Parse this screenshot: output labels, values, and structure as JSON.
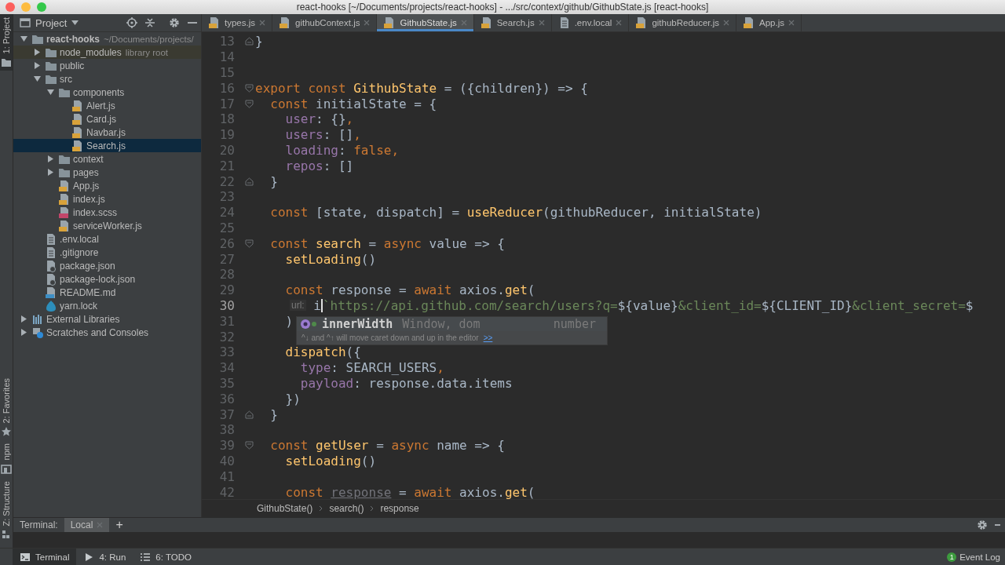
{
  "window": {
    "title": "react-hooks [~/Documents/projects/react-hooks] - .../src/context/github/GithubState.js [react-hooks]"
  },
  "tool_strip": [
    {
      "label": "1: Project",
      "selected": true
    },
    {
      "label": "2: Favorites",
      "selected": false
    },
    {
      "label": "npm",
      "selected": false
    },
    {
      "label": "Z: Structure",
      "selected": false
    }
  ],
  "project_panel": {
    "title": "Project",
    "tree": [
      {
        "label": "react-hooks",
        "hint": "~/Documents/projects/",
        "kind": "root",
        "expanded": true,
        "selected": false,
        "children": [
          {
            "label": "node_modules",
            "hint": "library root",
            "kind": "library-folder",
            "expanded": false,
            "selected": false
          },
          {
            "label": "public",
            "kind": "folder",
            "expanded": false,
            "selected": false
          },
          {
            "label": "src",
            "kind": "folder",
            "expanded": true,
            "selected": false,
            "children": [
              {
                "label": "components",
                "kind": "folder",
                "expanded": true,
                "selected": false,
                "children": [
                  {
                    "label": "Alert.js",
                    "kind": "js",
                    "selected": false
                  },
                  {
                    "label": "Card.js",
                    "kind": "js",
                    "selected": false
                  },
                  {
                    "label": "Navbar.js",
                    "kind": "js",
                    "selected": false
                  },
                  {
                    "label": "Search.js",
                    "kind": "js",
                    "selected": true
                  }
                ]
              },
              {
                "label": "context",
                "kind": "folder",
                "expanded": false,
                "selected": false
              },
              {
                "label": "pages",
                "kind": "folder",
                "expanded": false,
                "selected": false
              },
              {
                "label": "App.js",
                "kind": "js",
                "selected": false
              },
              {
                "label": "index.js",
                "kind": "js",
                "selected": false
              },
              {
                "label": "index.scss",
                "kind": "sass",
                "selected": false
              },
              {
                "label": "serviceWorker.js",
                "kind": "js",
                "selected": false
              }
            ]
          },
          {
            "label": ".env.local",
            "kind": "text",
            "selected": false
          },
          {
            "label": ".gitignore",
            "kind": "text",
            "selected": false
          },
          {
            "label": "package.json",
            "kind": "json",
            "selected": false
          },
          {
            "label": "package-lock.json",
            "kind": "json",
            "selected": false
          },
          {
            "label": "README.md",
            "kind": "md",
            "selected": false
          },
          {
            "label": "yarn.lock",
            "kind": "yarn",
            "selected": false
          }
        ]
      },
      {
        "label": "External Libraries",
        "kind": "libraries",
        "expanded": false,
        "selected": false
      },
      {
        "label": "Scratches and Consoles",
        "kind": "scratches",
        "expanded": false,
        "selected": false
      }
    ]
  },
  "tabs": [
    {
      "label": "types.js",
      "kind": "js",
      "selected": false
    },
    {
      "label": "githubContext.js",
      "kind": "js",
      "selected": false
    },
    {
      "label": "GithubState.js",
      "kind": "js",
      "selected": true
    },
    {
      "label": "Search.js",
      "kind": "js",
      "selected": false
    },
    {
      "label": ".env.local",
      "kind": "text",
      "selected": false
    },
    {
      "label": "githubReducer.js",
      "kind": "js",
      "selected": false
    },
    {
      "label": "App.js",
      "kind": "js",
      "selected": false
    }
  ],
  "code": [
    {
      "number": "13",
      "current": false,
      "fold_end": true,
      "tokens": [
        {
          "kind": "plain",
          "text": "}"
        }
      ]
    },
    {
      "number": "14",
      "current": false
    },
    {
      "number": "15",
      "current": false
    },
    {
      "number": "16",
      "current": false,
      "fold_start": true,
      "tokens": [
        {
          "kind": "kw",
          "text": "export const "
        },
        {
          "kind": "fn",
          "text": "GithubState"
        },
        {
          "kind": "plain",
          "text": " = ({children}) => {"
        }
      ]
    },
    {
      "number": "17",
      "current": false,
      "fold_start": true,
      "tokens": [
        {
          "kind": "kw",
          "text": "  const "
        },
        {
          "kind": "plain",
          "text": "initialState = {"
        }
      ]
    },
    {
      "number": "18",
      "current": false,
      "tokens": [
        {
          "kind": "prop",
          "text": "    user"
        },
        {
          "kind": "plain",
          "text": ": {}"
        },
        {
          "kind": "kw",
          "text": ","
        }
      ]
    },
    {
      "number": "19",
      "current": false,
      "tokens": [
        {
          "kind": "prop",
          "text": "    users"
        },
        {
          "kind": "plain",
          "text": ": []"
        },
        {
          "kind": "kw",
          "text": ","
        }
      ]
    },
    {
      "number": "20",
      "current": false,
      "tokens": [
        {
          "kind": "prop",
          "text": "    loading"
        },
        {
          "kind": "plain",
          "text": ": "
        },
        {
          "kind": "kw",
          "text": "false,"
        }
      ]
    },
    {
      "number": "21",
      "current": false,
      "tokens": [
        {
          "kind": "prop",
          "text": "    repos"
        },
        {
          "kind": "plain",
          "text": ": []"
        }
      ]
    },
    {
      "number": "22",
      "current": false,
      "fold_end": true,
      "tokens": [
        {
          "kind": "plain",
          "text": "  }"
        }
      ]
    },
    {
      "number": "23",
      "current": false
    },
    {
      "number": "24",
      "current": false,
      "tokens": [
        {
          "kind": "kw",
          "text": "  const "
        },
        {
          "kind": "plain",
          "text": "[state, dispatch] = "
        },
        {
          "kind": "fn",
          "text": "useReducer"
        },
        {
          "kind": "plain",
          "text": "(githubReducer, initialState)"
        }
      ]
    },
    {
      "number": "25",
      "current": false
    },
    {
      "number": "26",
      "current": false,
      "fold_start": true,
      "tokens": [
        {
          "kind": "kw",
          "text": "  const "
        },
        {
          "kind": "fn",
          "text": "search"
        },
        {
          "kind": "plain",
          "text": " = "
        },
        {
          "kind": "kw",
          "text": "async "
        },
        {
          "kind": "plain",
          "text": "value => {"
        }
      ]
    },
    {
      "number": "27",
      "current": false,
      "tokens": [
        {
          "kind": "fn",
          "text": "    setLoading"
        },
        {
          "kind": "plain",
          "text": "()"
        }
      ]
    },
    {
      "number": "28",
      "current": false
    },
    {
      "number": "29",
      "current": false,
      "tokens": [
        {
          "kind": "kw",
          "text": "    const "
        },
        {
          "kind": "plain",
          "text": "response = "
        },
        {
          "kind": "kw",
          "text": "await "
        },
        {
          "kind": "plain",
          "text": "axios."
        },
        {
          "kind": "fn",
          "text": "get"
        },
        {
          "kind": "plain",
          "text": "("
        }
      ]
    },
    {
      "number": "30",
      "current": true,
      "tokens": [
        {
          "kind": "hint",
          "text": "url:"
        },
        {
          "kind": "plain",
          "text": " i"
        },
        {
          "kind": "caret"
        },
        {
          "kind": "str",
          "text": "`https://api.github.com/search/users?q="
        },
        {
          "kind": "plain",
          "text": "${value}"
        },
        {
          "kind": "str",
          "text": "&client_id="
        },
        {
          "kind": "plain",
          "text": "${CLIENT_ID}"
        },
        {
          "kind": "str",
          "text": "&client_secret="
        },
        {
          "kind": "plain",
          "text": "$"
        }
      ]
    },
    {
      "number": "31",
      "current": false,
      "tokens": [
        {
          "kind": "plain",
          "text": "    )"
        }
      ]
    },
    {
      "number": "32",
      "current": false
    },
    {
      "number": "33",
      "current": false,
      "tokens": [
        {
          "kind": "fn",
          "text": "    dispatch"
        },
        {
          "kind": "plain",
          "text": "({"
        }
      ]
    },
    {
      "number": "34",
      "current": false,
      "tokens": [
        {
          "kind": "prop",
          "text": "      type"
        },
        {
          "kind": "plain",
          "text": ": SEARCH_USERS"
        },
        {
          "kind": "kw",
          "text": ","
        }
      ]
    },
    {
      "number": "35",
      "current": false,
      "tokens": [
        {
          "kind": "prop",
          "text": "      payload"
        },
        {
          "kind": "plain",
          "text": ": response.data.items"
        }
      ]
    },
    {
      "number": "36",
      "current": false,
      "tokens": [
        {
          "kind": "plain",
          "text": "    })"
        }
      ]
    },
    {
      "number": "37",
      "current": false,
      "fold_end": true,
      "tokens": [
        {
          "kind": "plain",
          "text": "  }"
        }
      ]
    },
    {
      "number": "38",
      "current": false
    },
    {
      "number": "39",
      "current": false,
      "fold_start": true,
      "tokens": [
        {
          "kind": "kw",
          "text": "  const "
        },
        {
          "kind": "fn",
          "text": "getUser"
        },
        {
          "kind": "plain",
          "text": " = "
        },
        {
          "kind": "kw",
          "text": "async "
        },
        {
          "kind": "plain",
          "text": "name => {"
        }
      ]
    },
    {
      "number": "40",
      "current": false,
      "tokens": [
        {
          "kind": "fn",
          "text": "    setLoading"
        },
        {
          "kind": "plain",
          "text": "()"
        }
      ]
    },
    {
      "number": "41",
      "current": false
    },
    {
      "number": "42",
      "current": false,
      "tokens": [
        {
          "kind": "kw",
          "text": "    const "
        },
        {
          "kind": "unused",
          "text": "response"
        },
        {
          "kind": "plain",
          "text": " = "
        },
        {
          "kind": "kw",
          "text": "await "
        },
        {
          "kind": "plain",
          "text": "axios."
        },
        {
          "kind": "fn",
          "text": "get"
        },
        {
          "kind": "plain",
          "text": "("
        }
      ]
    }
  ],
  "completion": {
    "name": "innerWidth",
    "type_text": "Window, dom",
    "return_type": "number",
    "hint": "^↓ and ^↑ will move caret down and up in the editor",
    "link": ">>"
  },
  "breadcrumbs": [
    "GithubState()",
    "search()",
    "response"
  ],
  "terminal": {
    "title": "Terminal:",
    "tabs": [
      {
        "label": "Local",
        "selected": true
      }
    ],
    "add": "+"
  },
  "bottom_bar": {
    "tools": [
      {
        "label": "Terminal",
        "selected": true
      },
      {
        "label": "4: Run",
        "selected": false
      },
      {
        "label": "6: TODO",
        "selected": false
      }
    ],
    "event_log": {
      "count": "1",
      "label": "Event Log"
    }
  }
}
